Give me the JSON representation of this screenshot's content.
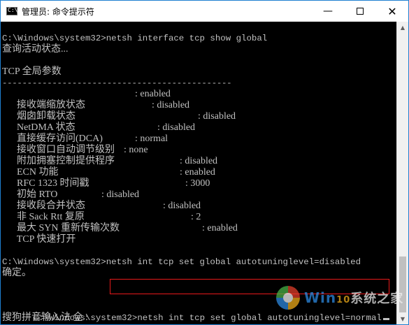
{
  "window": {
    "title": "管理员: 命令提示符",
    "icon_label": "C:\\",
    "controls": {
      "minimize": "—",
      "close": "✕"
    }
  },
  "console": {
    "cmd1": "C:\\Windows\\system32>netsh interface tcp show global",
    "querying": "查询活动状态...",
    "header": "TCP 全局参数",
    "separator": "----------------------------------------------",
    "settings": [
      {
        "name": "接收端缩放状态",
        "value": ": enabled"
      },
      {
        "name": "烟囱卸载状态",
        "value": ": disabled"
      },
      {
        "name": "NetDMA 状态",
        "value": ": disabled"
      },
      {
        "name": "直接缓存访问(DCA)",
        "value": ": disabled"
      },
      {
        "name": "接收窗口自动调节级别",
        "value": ": normal"
      },
      {
        "name": "附加拥塞控制提供程序",
        "value": ": none"
      },
      {
        "name": "ECN 功能",
        "value": ": disabled"
      },
      {
        "name": "RFC 1323 时间戳",
        "value": ": enabled"
      },
      {
        "name": "初始 RTO",
        "value": ": 3000"
      },
      {
        "name": "接收段合并状态",
        "value": ": disabled"
      },
      {
        "name": "非 Sack Rtt 复原",
        "value": ": disabled"
      },
      {
        "name": "最大 SYN 重新传输次数",
        "value": ": 2"
      },
      {
        "name": "TCP 快速打开",
        "value": ": enabled"
      }
    ],
    "cmd2": "C:\\Windows\\system32>netsh int tcp set global autotuninglevel=disabled",
    "ok": "确定。",
    "cmd3_prompt": "C:\\Windows\\system32>",
    "cmd3_command": "netsh int tcp set global autotuninglevel=normal",
    "ime_status": "搜狗拼音输入法 全 :"
  },
  "scrollbar": {
    "up_arrow": "▲",
    "down_arrow": "▼"
  },
  "watermark": {
    "brand_win": "Win",
    "brand_ten": "10",
    "brand_rest": "系统之家"
  },
  "colors": {
    "console_bg": "#000000",
    "console_text": "#c0c0c0",
    "highlight_border": "#e8191a",
    "window_border": "#1f7fd1"
  }
}
